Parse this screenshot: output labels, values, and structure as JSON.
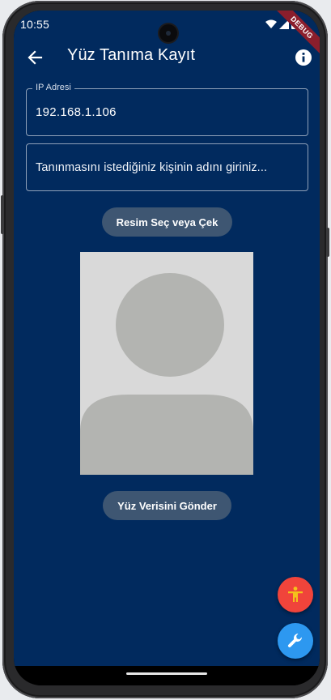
{
  "status_bar": {
    "time": "10:55",
    "icons": [
      "wifi-icon",
      "signal-icon",
      "battery-icon"
    ],
    "debug_badge": "DEBUG"
  },
  "app_bar": {
    "title": "Yüz Tanıma Kayıt",
    "back_icon": "arrow-left-icon",
    "info_icon": "info-icon"
  },
  "form": {
    "ip_label": "IP Adresi",
    "ip_value": "192.168.1.106",
    "name_placeholder": "Tanınmasını istediğiniz kişinin adını giriniz..."
  },
  "buttons": {
    "pick_image": "Resim Seç veya Çek",
    "send_face": "Yüz Verisini Gönder"
  },
  "fabs": {
    "accessibility_icon": "accessibility-icon",
    "tools_icon": "wrench-icon"
  },
  "colors": {
    "background": "#012a5e",
    "button": "#3e5672",
    "fab_accessibility": "#f0443b",
    "fab_tools": "#2d98f0",
    "placeholder_bg": "#d9d9d9",
    "placeholder_figure": "#b3b4b1"
  }
}
